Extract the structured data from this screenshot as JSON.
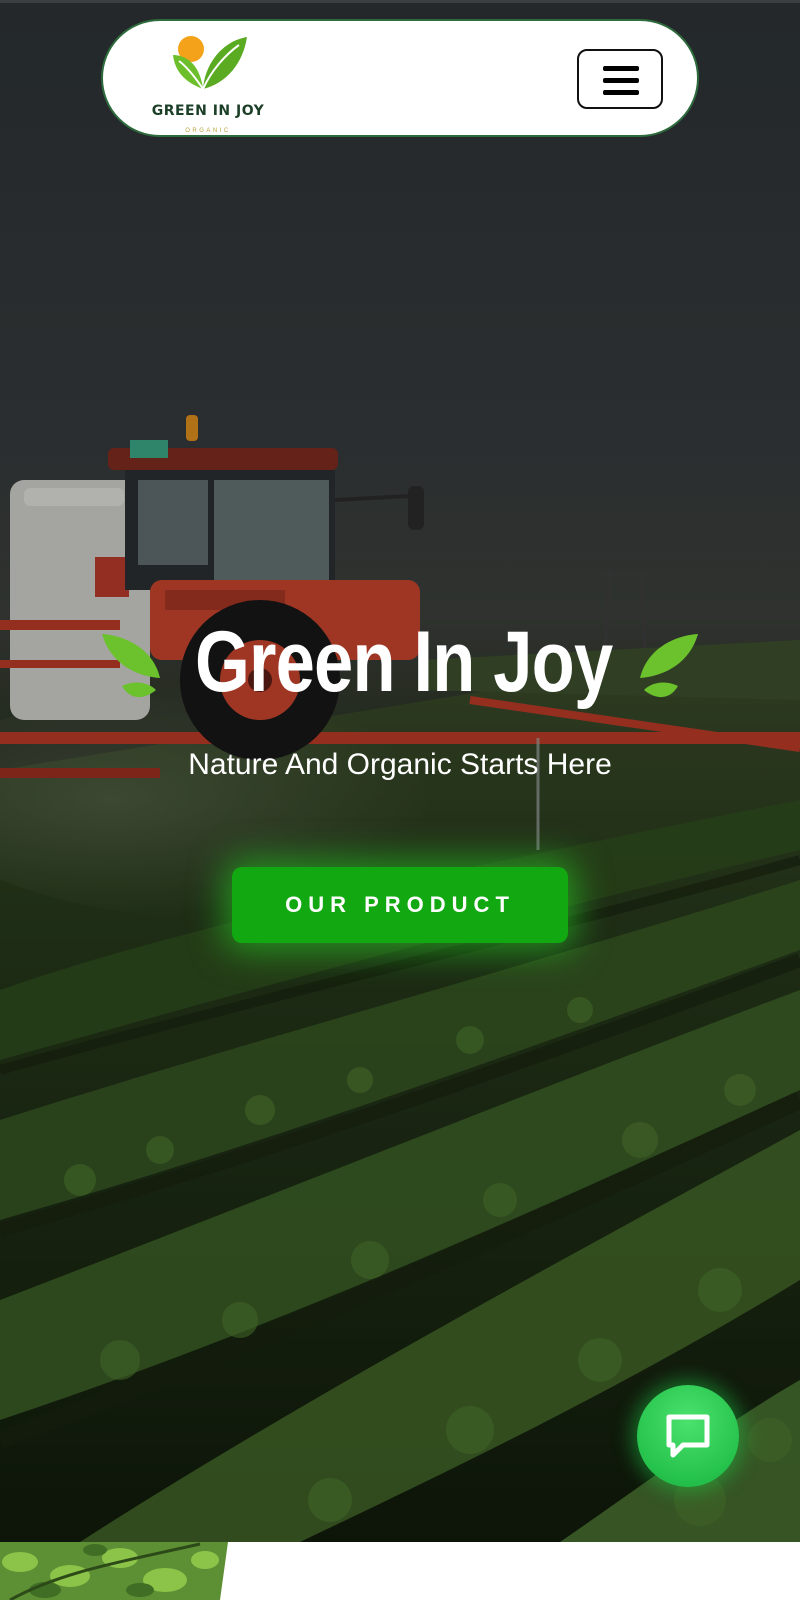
{
  "header": {
    "brand_name": "GREEN IN JOY",
    "brand_sub": "ORGANIC",
    "menu_icon": "hamburger-menu-icon"
  },
  "hero": {
    "title": "Green In Joy",
    "subtitle": "Nature And Organic Starts Here",
    "cta_label": "OUR PRODUCT",
    "decor_icons": [
      "leaf-icon",
      "leaf-icon"
    ]
  },
  "chat": {
    "icon": "chat-bubble-icon"
  },
  "colors": {
    "brand_green": "#12a812",
    "chat_green": "#25c24c",
    "logo_leaf": "#6cbf2a",
    "logo_sun": "#f4a21a",
    "brand_text": "#1c3f28",
    "sub_text": "#b9a13a"
  }
}
